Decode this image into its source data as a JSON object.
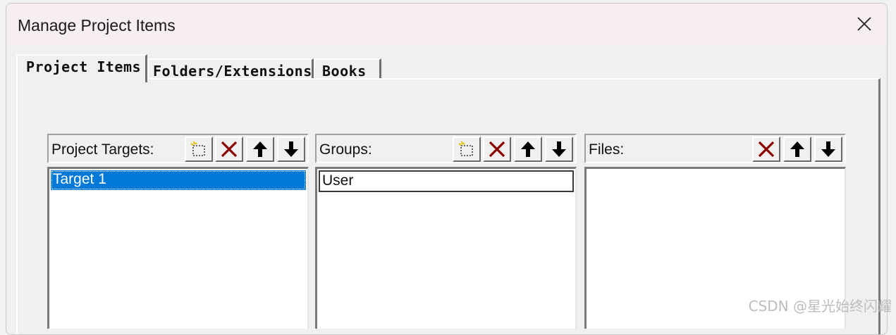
{
  "window": {
    "title": "Manage Project Items"
  },
  "tabs": [
    {
      "label": "Project Items",
      "active": true
    },
    {
      "label": "Folders/Extensions",
      "active": false
    },
    {
      "label": "Books",
      "active": false
    }
  ],
  "panels": {
    "targets": {
      "label": "Project Targets:",
      "buttons": [
        "new-icon",
        "delete-icon",
        "move-up-icon",
        "move-down-icon"
      ],
      "items": [
        {
          "text": "Target 1",
          "selected": true
        }
      ]
    },
    "groups": {
      "label": "Groups:",
      "buttons": [
        "new-icon",
        "delete-icon",
        "move-up-icon",
        "move-down-icon"
      ],
      "items": [
        {
          "text": "User",
          "editing": true
        }
      ]
    },
    "files": {
      "label": "Files:",
      "buttons": [
        "delete-icon",
        "move-up-icon",
        "move-down-icon"
      ],
      "items": []
    }
  },
  "watermark": "CSDN @星光始终闪耀",
  "colors": {
    "selection": "#0078d7",
    "delete_icon": "#8b0000"
  }
}
